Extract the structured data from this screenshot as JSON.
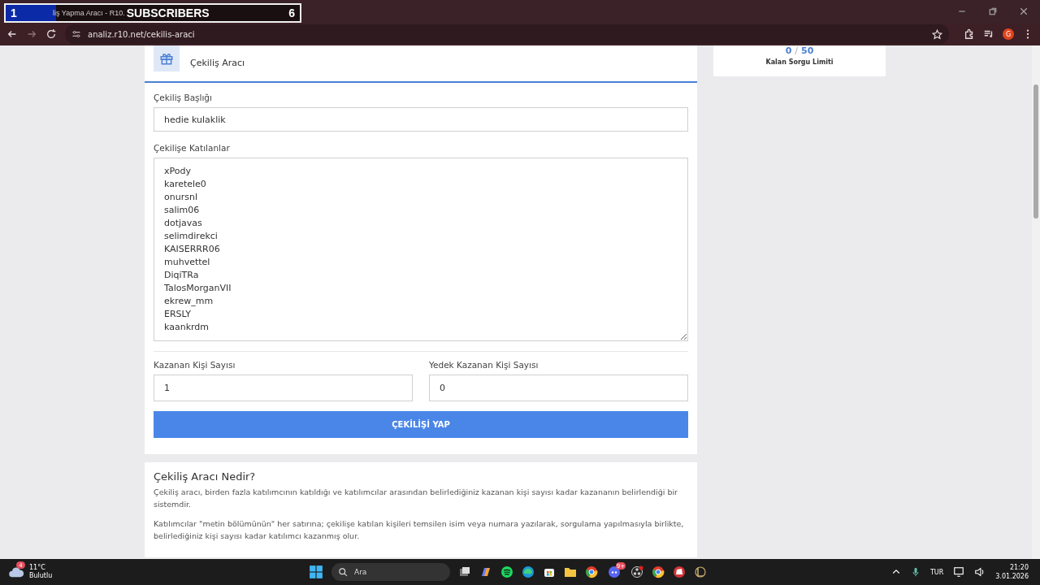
{
  "overlay": {
    "count": "1",
    "label": "SUBSCRIBERS",
    "goal": "6",
    "level": 0.17
  },
  "tab": {
    "title": "liş Yapma Aracı - R10."
  },
  "address_bar": {
    "url": "analiz.r10.net/cekilis-araci",
    "profile": "G"
  },
  "tool_card": {
    "title": "Çekiliş Aracı",
    "title_field": {
      "label": "Çekiliş Başlığı",
      "value": "hedie kulaklik"
    },
    "participants": {
      "label": "Çekilişe Katılanlar",
      "lines": [
        "xPody",
        "karetele0",
        "onursnl",
        "salim06",
        "dotjavas",
        "selimdirekci",
        "KAISERRR06",
        "muhvettel",
        "DiqiTRa",
        "TalosMorganVII",
        "ekrew_mm",
        "ERSLY",
        "kaankrdm"
      ]
    },
    "winners": {
      "label": "Kazanan Kişi Sayısı",
      "value": "1"
    },
    "backups": {
      "label": "Yedek Kazanan Kişi Sayısı",
      "value": "0"
    },
    "submit": "ÇEKİLİŞİ YAP"
  },
  "limit_card": {
    "used": "0",
    "separator": "/",
    "total": "50",
    "label": "Kalan Sorgu Limiti"
  },
  "info_card": {
    "heading": "Çekiliş Aracı Nedir?",
    "paragraphs": [
      "Çekiliş aracı, birden fazla katılımcının katıldığı ve katılımcılar arasından belirlediğiniz kazanan kişi sayısı kadar kazananın belirlendiği bir sistemdir.",
      "Katılımcılar \"metin bölümünün\" her satırına; çekilişe katılan kişileri temsilen isim veya numara yazılarak, sorgulama yapılmasıyla birlikte, belirlediğiniz kişi sayısı kadar katılımcı kazanmış olur."
    ]
  },
  "taskbar": {
    "weather": {
      "temp": "11°C",
      "condition": "Bulutlu",
      "badge": "4"
    },
    "search": "Ara",
    "discord_badge": "9+",
    "language": "TUR",
    "time": "21:20",
    "date": "3.01.2026"
  }
}
